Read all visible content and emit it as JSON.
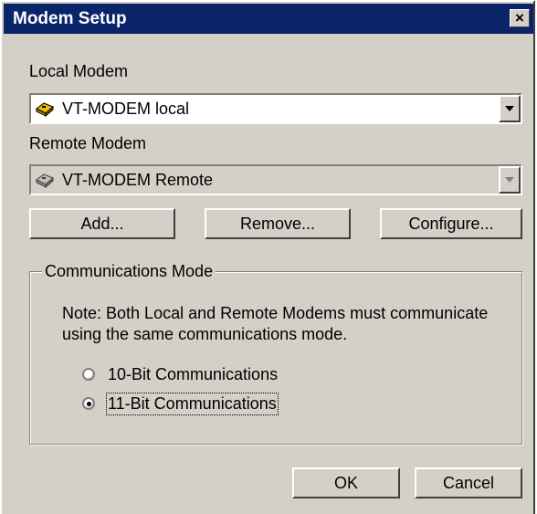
{
  "window": {
    "title": "Modem Setup",
    "close_label": "×"
  },
  "local": {
    "label": "Local Modem",
    "value": "VT-MODEM local",
    "icon": "modem-icon"
  },
  "remote": {
    "label": "Remote Modem",
    "value": "VT-MODEM Remote",
    "icon": "modem-icon"
  },
  "buttons": {
    "add": "Add...",
    "remove": "Remove...",
    "configure": "Configure...",
    "ok": "OK",
    "cancel": "Cancel"
  },
  "comm": {
    "legend": "Communications Mode",
    "note": "Note: Both Local and Remote Modems must communicate using the same communications mode.",
    "options": [
      {
        "label": "10-Bit Communications",
        "selected": false
      },
      {
        "label": "11-Bit Communications",
        "selected": true
      }
    ]
  },
  "colors": {
    "title_bar": "#0a246a",
    "dialog_face": "#d4d0c8"
  }
}
